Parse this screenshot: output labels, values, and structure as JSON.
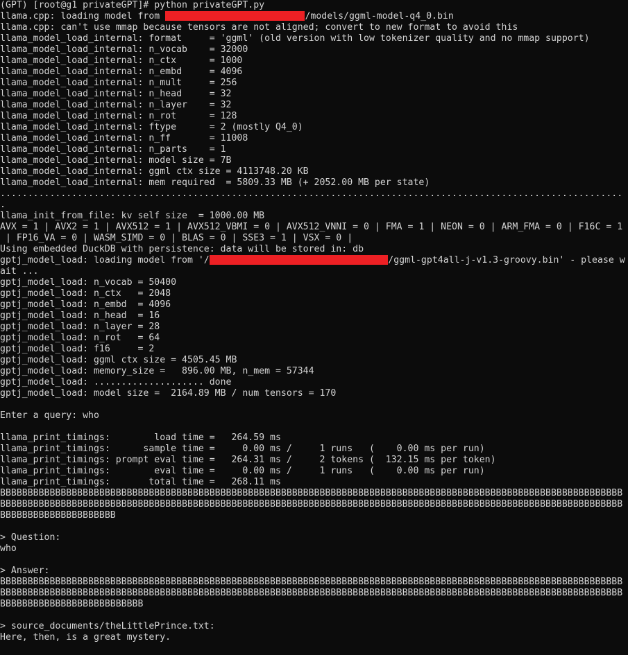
{
  "terminal": {
    "background_color": "#0c0c0c",
    "text_color": "#d4d4d4",
    "redaction_color": "#ed2024",
    "prompt_line": "(GPT) [root@g1 privateGPT]# python privateGPT.py",
    "lines": [
      {
        "type": "text",
        "text": "(GPT) [root@g1 privateGPT]# python privateGPT.py"
      },
      {
        "type": "redacted",
        "prefix": "llama.cpp: loading model from ",
        "redaction_chars": 25,
        "suffix": "/models/ggml-model-q4_0.bin"
      },
      {
        "type": "text",
        "text": "llama.cpp: can't use mmap because tensors are not aligned; convert to new format to avoid this"
      },
      {
        "type": "text",
        "text": "llama_model_load_internal: format     = 'ggml' (old version with low tokenizer quality and no mmap support)"
      },
      {
        "type": "text",
        "text": "llama_model_load_internal: n_vocab    = 32000"
      },
      {
        "type": "text",
        "text": "llama_model_load_internal: n_ctx      = 1000"
      },
      {
        "type": "text",
        "text": "llama_model_load_internal: n_embd     = 4096"
      },
      {
        "type": "text",
        "text": "llama_model_load_internal: n_mult     = 256"
      },
      {
        "type": "text",
        "text": "llama_model_load_internal: n_head     = 32"
      },
      {
        "type": "text",
        "text": "llama_model_load_internal: n_layer    = 32"
      },
      {
        "type": "text",
        "text": "llama_model_load_internal: n_rot      = 128"
      },
      {
        "type": "text",
        "text": "llama_model_load_internal: ftype      = 2 (mostly Q4_0)"
      },
      {
        "type": "text",
        "text": "llama_model_load_internal: n_ff       = 11008"
      },
      {
        "type": "text",
        "text": "llama_model_load_internal: n_parts    = 1"
      },
      {
        "type": "text",
        "text": "llama_model_load_internal: model size = 7B"
      },
      {
        "type": "text",
        "text": "llama_model_load_internal: ggml ctx size = 4113748.20 KB"
      },
      {
        "type": "text",
        "text": "llama_model_load_internal: mem required  = 5809.33 MB (+ 2052.00 MB per state)"
      },
      {
        "type": "dots",
        "count": 113
      },
      {
        "type": "text",
        "text": "."
      },
      {
        "type": "text",
        "text": "llama_init_from_file: kv self size  = 1000.00 MB"
      },
      {
        "type": "text",
        "text": "AVX = 1 | AVX2 = 1 | AVX512 = 1 | AVX512_VBMI = 0 | AVX512_VNNI = 0 | FMA = 1 | NEON = 0 | ARM_FMA = 0 | F16C = 1"
      },
      {
        "type": "text",
        "text": " | FP16_VA = 0 | WASM_SIMD = 0 | BLAS = 0 | SSE3 = 1 | VSX = 0 | "
      },
      {
        "type": "text",
        "text": "Using embedded DuckDB with persistence: data will be stored in: db"
      },
      {
        "type": "redacted",
        "prefix": "gptj_model_load: loading model from '/",
        "redaction_chars": 32,
        "suffix": "/ggml-gpt4all-j-v1.3-groovy.bin' - please w"
      },
      {
        "type": "text",
        "text": "ait ..."
      },
      {
        "type": "text",
        "text": "gptj_model_load: n_vocab = 50400"
      },
      {
        "type": "text",
        "text": "gptj_model_load: n_ctx   = 2048"
      },
      {
        "type": "text",
        "text": "gptj_model_load: n_embd  = 4096"
      },
      {
        "type": "text",
        "text": "gptj_model_load: n_head  = 16"
      },
      {
        "type": "text",
        "text": "gptj_model_load: n_layer = 28"
      },
      {
        "type": "text",
        "text": "gptj_model_load: n_rot   = 64"
      },
      {
        "type": "text",
        "text": "gptj_model_load: f16     = 2"
      },
      {
        "type": "text",
        "text": "gptj_model_load: ggml ctx size = 4505.45 MB"
      },
      {
        "type": "text",
        "text": "gptj_model_load: memory_size =   896.00 MB, n_mem = 57344"
      },
      {
        "type": "text",
        "text": "gptj_model_load: .................... done"
      },
      {
        "type": "text",
        "text": "gptj_model_load: model size =  2164.89 MB / num tensors = 170"
      },
      {
        "type": "blank"
      },
      {
        "type": "text",
        "text": "Enter a query: who"
      },
      {
        "type": "blank"
      },
      {
        "type": "text",
        "text": "llama_print_timings:        load time =   264.59 ms"
      },
      {
        "type": "text",
        "text": "llama_print_timings:      sample time =     0.00 ms /     1 runs   (    0.00 ms per run)"
      },
      {
        "type": "text",
        "text": "llama_print_timings: prompt eval time =   264.31 ms /     2 tokens (  132.15 ms per token)"
      },
      {
        "type": "text",
        "text": "llama_print_timings:        eval time =     0.00 ms /     1 runs   (    0.00 ms per run)"
      },
      {
        "type": "text",
        "text": "llama_print_timings:       total time =   268.11 ms"
      },
      {
        "type": "bseq",
        "count": 247
      },
      {
        "type": "blank"
      },
      {
        "type": "text",
        "text": "> Question:"
      },
      {
        "type": "text",
        "text": "who"
      },
      {
        "type": "blank"
      },
      {
        "type": "text",
        "text": "> Answer:"
      },
      {
        "type": "bseq",
        "count": 252
      },
      {
        "type": "blank"
      },
      {
        "type": "text",
        "text": "> source_documents/theLittlePrince.txt:"
      },
      {
        "type": "text",
        "text": "Here, then, is a great mystery."
      }
    ]
  }
}
